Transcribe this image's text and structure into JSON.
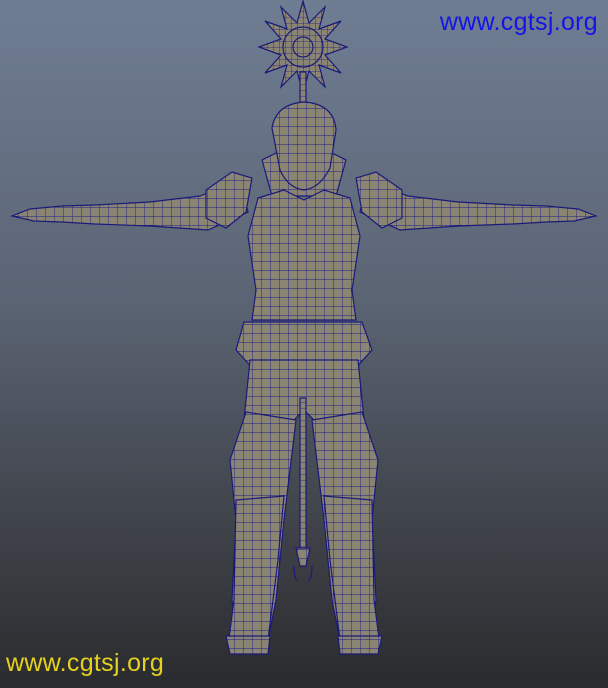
{
  "watermark": {
    "top_text": "www.cgtsj.org",
    "bottom_text": "www.cgtsj.org",
    "top_color": "#1414e6",
    "bottom_color": "#e6d21e"
  },
  "viewport": {
    "content": "wireframe-character-model",
    "mesh_color": "#8a8473",
    "wire_color": "#1a1a7a",
    "background_top": "#6f7d93",
    "background_bottom": "#2a2b2e"
  }
}
